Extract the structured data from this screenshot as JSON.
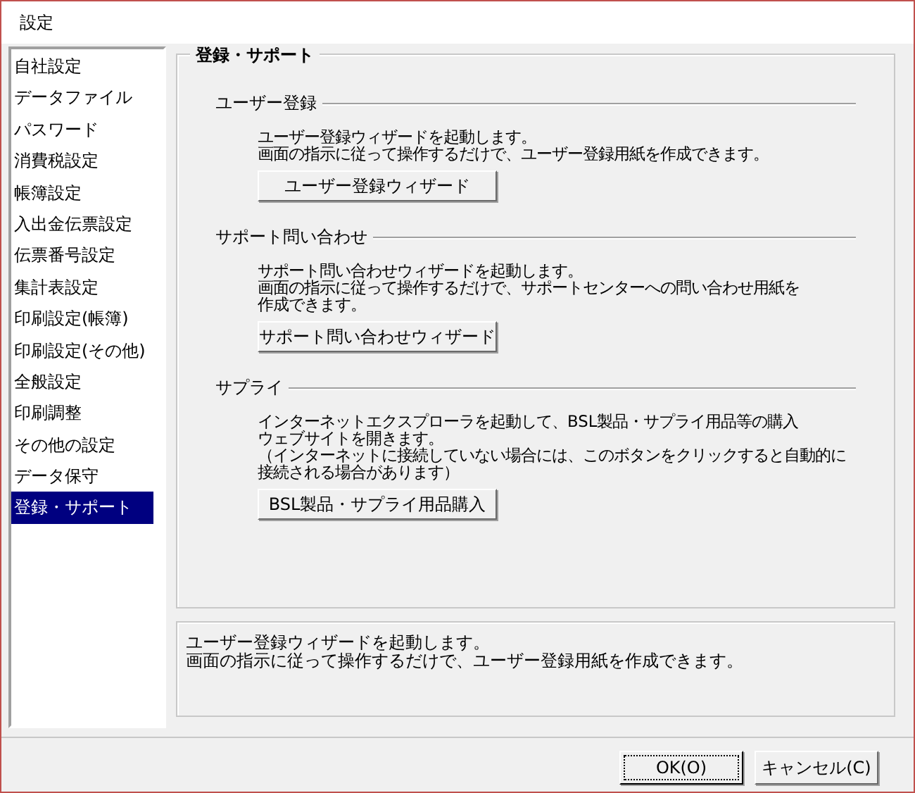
{
  "window": {
    "title": "設定"
  },
  "sidebar": {
    "items": [
      {
        "label": "自社設定",
        "selected": false
      },
      {
        "label": "データファイル",
        "selected": false
      },
      {
        "label": "パスワード",
        "selected": false
      },
      {
        "label": "消費税設定",
        "selected": false
      },
      {
        "label": "帳簿設定",
        "selected": false
      },
      {
        "label": "入出金伝票設定",
        "selected": false
      },
      {
        "label": "伝票番号設定",
        "selected": false
      },
      {
        "label": "集計表設定",
        "selected": false
      },
      {
        "label": "印刷設定(帳簿)",
        "selected": false
      },
      {
        "label": "印刷設定(その他)",
        "selected": false
      },
      {
        "label": "全般設定",
        "selected": false
      },
      {
        "label": "印刷調整",
        "selected": false
      },
      {
        "label": "その他の設定",
        "selected": false
      },
      {
        "label": "データ保守",
        "selected": false
      },
      {
        "label": "登録・サポート",
        "selected": true
      }
    ]
  },
  "panel": {
    "title": "登録・サポート",
    "sections": [
      {
        "heading": "ユーザー登録",
        "lines": [
          "ユーザー登録ウィザードを起動します。",
          "画面の指示に従って操作するだけで、ユーザー登録用紙を作成できます。"
        ],
        "button": "ユーザー登録ウィザード"
      },
      {
        "heading": "サポート問い合わせ",
        "lines": [
          "サポート問い合わせウィザードを起動します。",
          "画面の指示に従って操作するだけで、サポートセンターへの問い合わせ用紙を",
          "作成できます。"
        ],
        "button": "サポート問い合わせウィザード"
      },
      {
        "heading": "サプライ",
        "lines": [
          "インターネットエクスプローラを起動して、BSL製品・サプライ用品等の購入",
          "ウェブサイトを開きます。",
          "（インターネットに接続していない場合には、このボタンをクリックすると自動的に",
          "接続される場合があります）"
        ],
        "button": "BSL製品・サプライ用品購入"
      }
    ]
  },
  "help": {
    "lines": [
      "ユーザー登録ウィザードを起動します。",
      "画面の指示に従って操作するだけで、ユーザー登録用紙を作成できます。"
    ]
  },
  "buttons": [
    {
      "label": "OK(O)",
      "default": true
    },
    {
      "label": "キャンセル(C)",
      "default": false
    }
  ]
}
